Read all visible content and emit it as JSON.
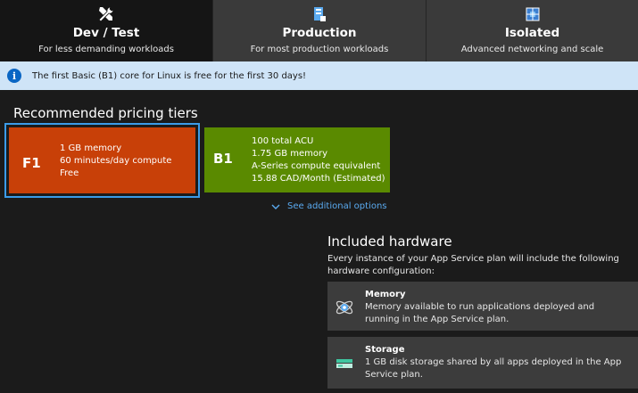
{
  "tabs": [
    {
      "name": "Dev / Test",
      "description": "For less demanding workloads",
      "icon": "tools-icon",
      "active": true
    },
    {
      "name": "Production",
      "description": "For most production workloads",
      "icon": "production-server-icon",
      "active": false
    },
    {
      "name": "Isolated",
      "description": "Advanced networking and scale",
      "icon": "isolated-network-icon",
      "active": false
    }
  ],
  "info": {
    "icon": "info-icon",
    "text": "The first Basic (B1) core for Linux is free for the first 30 days!"
  },
  "recommended": {
    "title": "Recommended pricing tiers",
    "tiers": [
      {
        "code": "F1",
        "lines": [
          "1 GB memory",
          "60 minutes/day compute",
          "Free"
        ],
        "color": "#c84008",
        "selected": true
      },
      {
        "code": "B1",
        "lines": [
          "100 total ACU",
          "1.75 GB memory",
          "A-Series compute equivalent",
          "15.88 CAD/Month (Estimated)"
        ],
        "color": "#5a8a00",
        "selected": false
      }
    ],
    "more_link": "See additional options"
  },
  "hardware": {
    "title": "Included hardware",
    "description": "Every instance of your App Service plan will include the following hardware configuration:",
    "items": [
      {
        "name": "Memory",
        "description": "Memory available to run applications deployed and running in the App Service plan.",
        "icon": "memory-icon"
      },
      {
        "name": "Storage",
        "description": "1 GB disk storage shared by all apps deployed in the App Service plan.",
        "icon": "storage-icon"
      }
    ]
  },
  "colors": {
    "accent_blue": "#0a66c4",
    "link_blue": "#5aaaf0",
    "selected_border": "#3b9be8",
    "info_background": "#cfe4f7"
  }
}
